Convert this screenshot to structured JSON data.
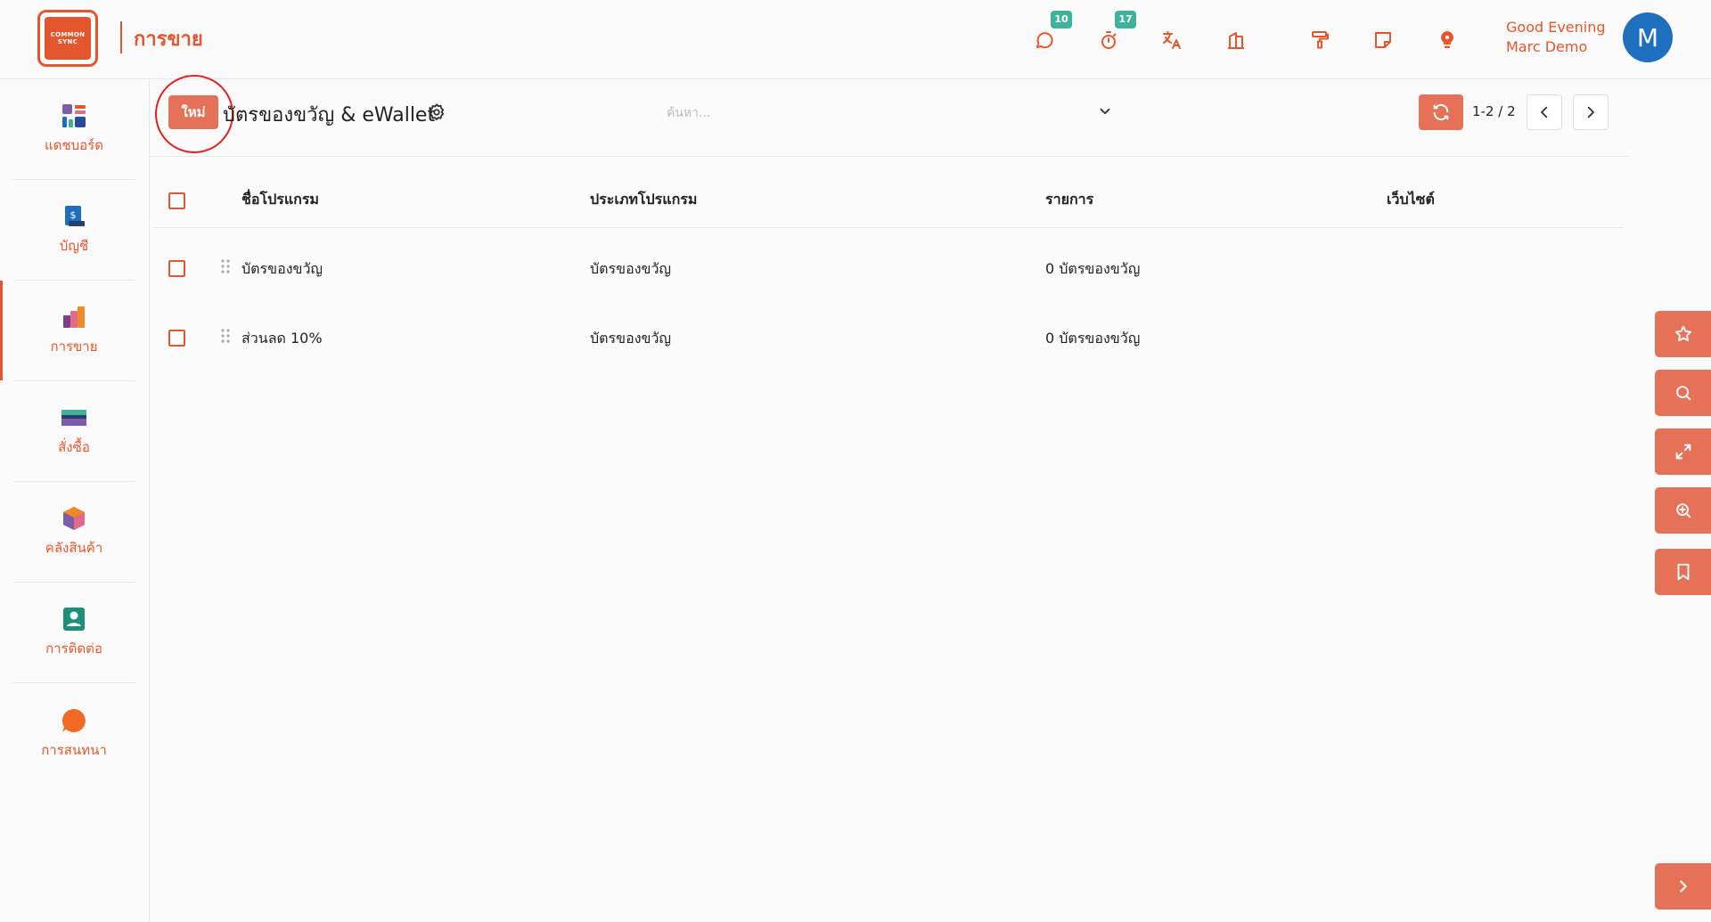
{
  "header": {
    "logo_text_1": "COMMON",
    "logo_text_2": "SYNC",
    "app_title": "การขาย",
    "chat_badge": "10",
    "activity_badge": "17",
    "greeting": "Good Evening",
    "user_name": "Marc Demo",
    "avatar_letter": "M",
    "icons": [
      "chat-icon",
      "stopwatch-icon",
      "translate-icon",
      "company-icon",
      "paint-roller-icon",
      "note-icon",
      "lightbulb-icon"
    ]
  },
  "sidebar": {
    "items": [
      {
        "label": "แดชบอร์ด",
        "icon": "dashboard-icon"
      },
      {
        "label": "บัญชี",
        "icon": "accounting-icon"
      },
      {
        "label": "การขาย",
        "icon": "sales-icon"
      },
      {
        "label": "สั่งซื้อ",
        "icon": "purchase-icon"
      },
      {
        "label": "คลังสินค้า",
        "icon": "inventory-icon"
      },
      {
        "label": "การติดต่อ",
        "icon": "contacts-icon"
      },
      {
        "label": "การสนทนา",
        "icon": "discuss-icon"
      }
    ],
    "active_index": 2
  },
  "control": {
    "new_label": "ใหม่",
    "title": "บัตรของขวัญ & eWallet",
    "search_placeholder": "ค้นหา...",
    "pager": "1-2 / 2"
  },
  "table": {
    "columns": [
      "ชื่อโปรแกรม",
      "ประเภทโปรแกรม",
      "รายการ",
      "เว็บไซต์"
    ],
    "rows": [
      {
        "name": "บัตรของขวัญ",
        "type": "บัตรของขวัญ",
        "items": "0 บัตรของขวัญ",
        "website": ""
      },
      {
        "name": "ส่วนลด 10%",
        "type": "บัตรของขวัญ",
        "items": "0 บัตรของขวัญ",
        "website": ""
      }
    ]
  },
  "colors": {
    "accent": "#e4572e",
    "button": "#e57258",
    "badge": "#3fb39a",
    "avatar": "#1f6fbf"
  }
}
